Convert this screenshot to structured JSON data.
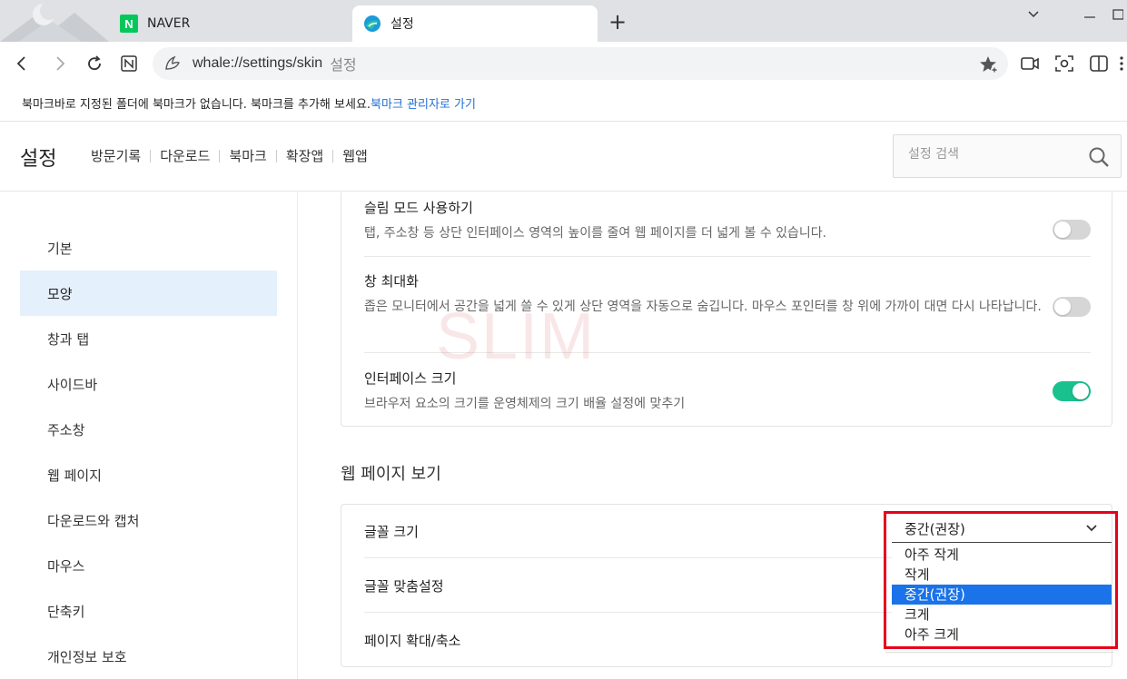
{
  "tabs": [
    {
      "label": "NAVER",
      "favicon": "N"
    },
    {
      "label": "설정"
    }
  ],
  "toolbar": {
    "url": "whale://settings/skin",
    "page_name": "설정"
  },
  "bookmark_bar": {
    "message": "북마크바로 지정된 폴더에 북마크가 없습니다. 북마크를 추가해 보세요.",
    "link": "북마크 관리자로 가기"
  },
  "header": {
    "title": "설정",
    "nav": [
      "방문기록",
      "다운로드",
      "북마크",
      "확장앱",
      "웹앱"
    ],
    "search_placeholder": "설정 검색"
  },
  "sidebar": {
    "items": [
      "기본",
      "모양",
      "창과 탭",
      "사이드바",
      "주소창",
      "웹 페이지",
      "다운로드와 캡처",
      "마우스",
      "단축키",
      "개인정보 보호"
    ],
    "active_index": 1
  },
  "appearance": {
    "slim_title": "슬림 모드 사용하기",
    "slim_desc": "탭, 주소창 등 상단 인터페이스 영역의 높이를 줄여 웹 페이지를 더 넓게 볼 수 있습니다.",
    "slim_on": false,
    "max_title": "창 최대화",
    "max_desc": "좁은 모니터에서 공간을 넓게 쓸 수 있게 상단 영역을 자동으로 숨깁니다. 마우스 포인터를 창 위에 가까이 대면 다시 나타납니다.",
    "max_on": false,
    "iface_title": "인터페이스 크기",
    "iface_desc": "브라우저 요소의 크기를 운영체제의 크기 배율 설정에 맞추기",
    "iface_on": true
  },
  "webview": {
    "section_title": "웹 페이지 보기",
    "font_size_label": "글꼴 크기",
    "font_custom_label": "글꼴 맞춤설정",
    "zoom_label": "페이지 확대/축소"
  },
  "font_dropdown": {
    "selected": "중간(권장)",
    "options": [
      "아주 작게",
      "작게",
      "중간(권장)",
      "크게",
      "아주 크게"
    ],
    "highlight_index": 2
  },
  "watermark": "SLIM",
  "colors": {
    "accent": "#19c18f",
    "selection": "#1a73e8",
    "highlight_box": "#e8001c",
    "sidebar_active": "#e4f0fc"
  }
}
